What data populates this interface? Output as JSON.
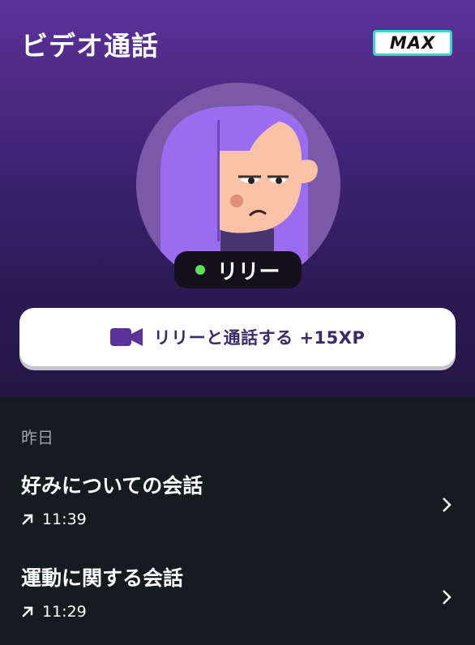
{
  "header": {
    "title": "ビデオ通話",
    "badge": "MAX"
  },
  "contact": {
    "name": "リリー",
    "status_color": "#5fe05b"
  },
  "call_button": {
    "label": "リリーと通話する +15XP",
    "icon": "video-camera-icon"
  },
  "history": {
    "section_label": "昨日",
    "items": [
      {
        "title": "好みについての会話",
        "time": "11:39",
        "icon": "arrow-up-right-icon"
      },
      {
        "title": "運動に関する会話",
        "time": "11:29",
        "icon": "arrow-up-right-icon"
      }
    ]
  },
  "colors": {
    "accent": "#5b3299",
    "badge_border": "#38d6c4",
    "list_background": "#151c20"
  }
}
